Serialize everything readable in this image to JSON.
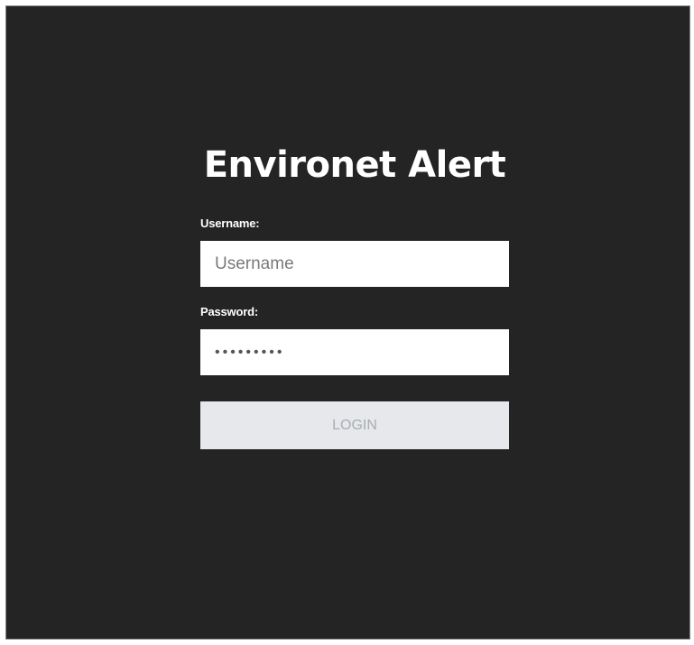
{
  "login": {
    "title": "Environet Alert",
    "username_label": "Username:",
    "username_placeholder": "Username",
    "username_value": "",
    "password_label": "Password:",
    "password_value": "•••••••••",
    "login_button": "LOGIN"
  },
  "colors": {
    "background": "#242424",
    "input_background": "#ffffff",
    "button_background": "#e6e8eb",
    "button_text": "#a9adb2"
  }
}
